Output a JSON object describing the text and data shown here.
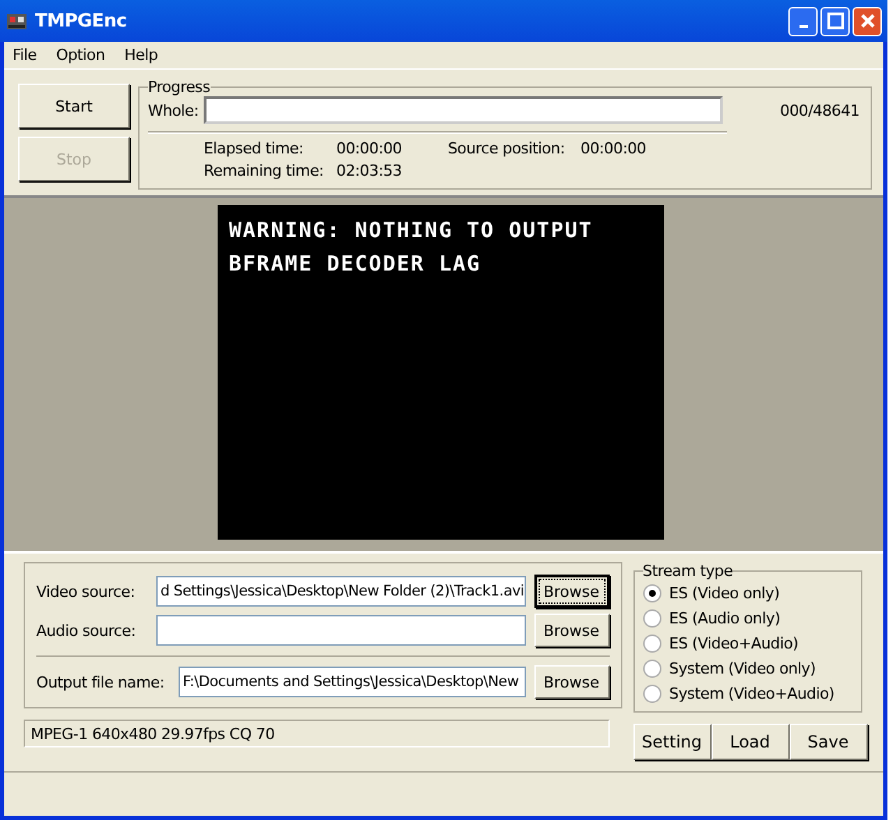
{
  "window": {
    "title": "TMPGEnc"
  },
  "menu": [
    "File",
    "Option",
    "Help"
  ],
  "buttons": [
    {
      "label": "Start",
      "disabled": false
    },
    {
      "label": "Stop",
      "disabled": true
    }
  ],
  "progress": {
    "title": "Progress",
    "whole_label": "Whole:",
    "level": 0,
    "count": "000/48641",
    "stats": [
      {
        "label": "Elapsed time:",
        "value": "00:00:00"
      },
      {
        "label": "Remaining time:",
        "value": "02:03:53"
      },
      {
        "label": "Source position:",
        "value": "00:00:00"
      }
    ]
  },
  "preview": {
    "lines": [
      "WARNING: NOTHING TO OUTPUT",
      "BFRAME DECODER LAG"
    ]
  },
  "sources": [
    {
      "label": "Video source:",
      "value": "d Settings\\Jessica\\Desktop\\New Folder (2)\\Track1.avi",
      "button": "Browse",
      "focused": true
    },
    {
      "label": "Audio source:",
      "button": "Browse",
      "focused": false
    },
    {
      "label": "Output file name:",
      "value": "F:\\Documents and Settings\\Jessica\\Desktop\\New",
      "button": "Browse",
      "focused": false
    }
  ],
  "stream_type": {
    "title": "Stream type",
    "options": [
      {
        "label": "ES (Video only)",
        "selected": true
      },
      {
        "label": "ES (Audio only)",
        "selected": false
      },
      {
        "label": "ES (Video+Audio)",
        "selected": false
      },
      {
        "label": "System (Video only)",
        "selected": false
      },
      {
        "label": "System (Video+Audio)",
        "selected": false
      }
    ]
  },
  "settings_summary": "MPEG-1 640x480 29.97fps CQ 70",
  "actions": [
    "Setting",
    "Load",
    "Save"
  ]
}
